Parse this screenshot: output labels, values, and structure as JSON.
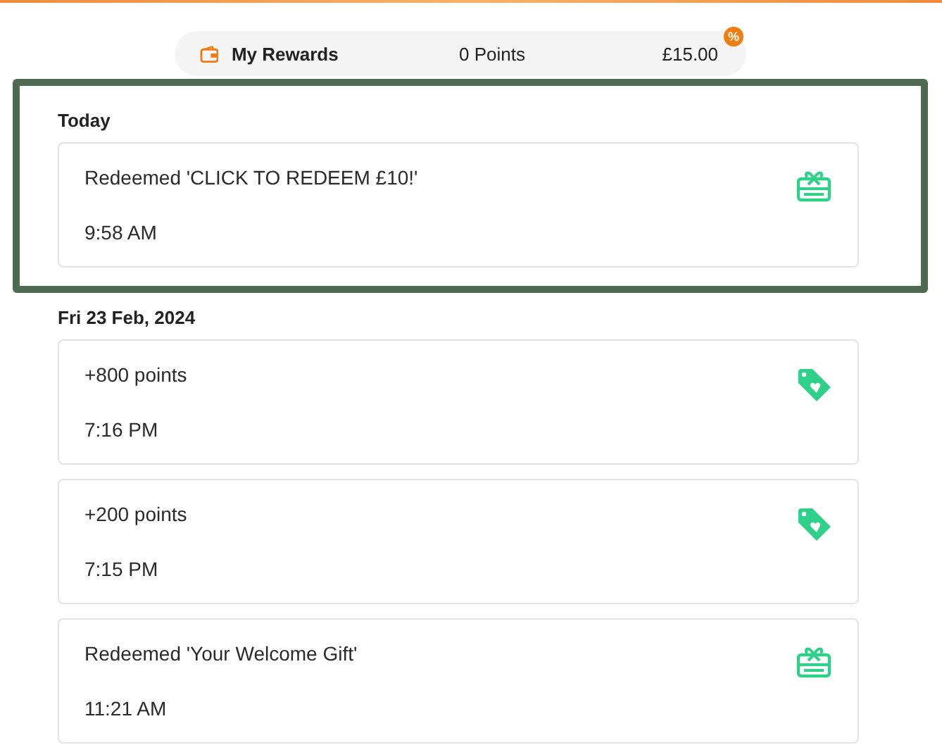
{
  "header": {
    "title": "My Rewards",
    "points": "0 Points",
    "balance": "£15.00",
    "badge": "%"
  },
  "groups": [
    {
      "heading": "Today",
      "highlighted": true,
      "items": [
        {
          "kind": "gift",
          "title": "Redeemed 'CLICK TO REDEEM £10!'",
          "time": "9:58 AM"
        }
      ]
    },
    {
      "heading": "Fri 23 Feb, 2024",
      "highlighted": false,
      "items": [
        {
          "kind": "tag",
          "title": "+800 points",
          "time": "7:16 PM"
        },
        {
          "kind": "tag",
          "title": "+200 points",
          "time": "7:15 PM"
        },
        {
          "kind": "gift",
          "title": "Redeemed 'Your Welcome Gift'",
          "time": "11:21 AM"
        }
      ]
    }
  ]
}
